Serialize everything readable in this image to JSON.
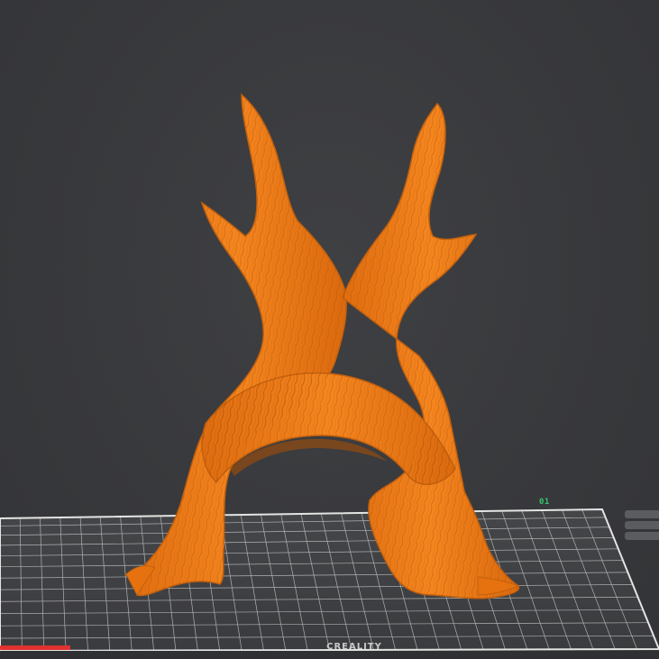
{
  "viewport": {
    "background_color": "#38393c",
    "model_color": "#f07d1a",
    "bed_color": "#3e3f42",
    "grid_color": "#d8d8d8"
  },
  "build_plate": {
    "plate_number": "01",
    "brand_text": "CREALITY"
  },
  "model": {
    "shape": "tree-arch"
  }
}
